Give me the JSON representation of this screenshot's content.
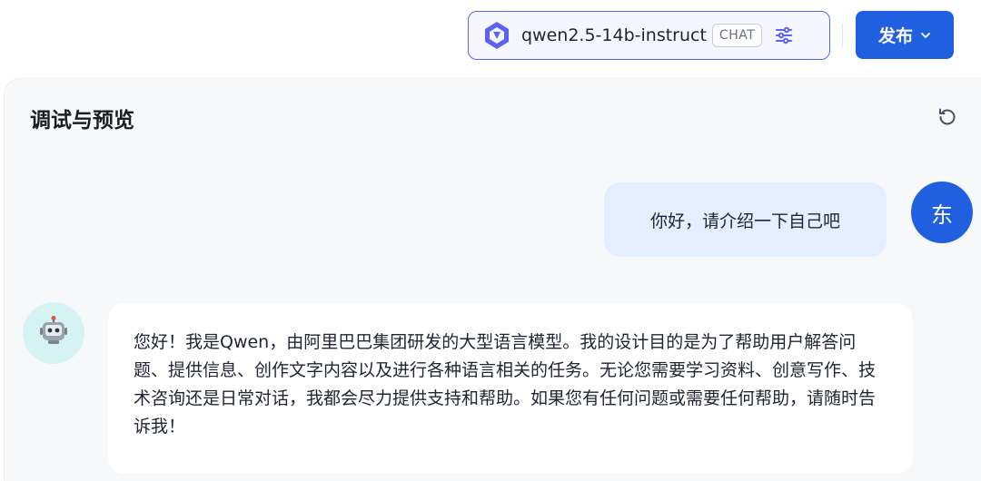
{
  "header": {
    "model_name": "qwen2.5-14b-instruct",
    "model_badge": "CHAT",
    "publish_label": "发布",
    "accent_color": "#1f5fe0",
    "selector_border_color": "#5b63f5"
  },
  "panel": {
    "title": "调试与预览"
  },
  "messages": [
    {
      "role": "user",
      "avatar_text": "东",
      "text": "你好，请介绍一下自己吧"
    },
    {
      "role": "assistant",
      "avatar_icon": "robot-icon",
      "text": "您好！我是Qwen，由阿里巴巴集团研发的大型语言模型。我的设计目的是为了帮助用户解答问题、提供信息、创作文字内容以及进行各种语言相关的任务。无论您需要学习资料、创意写作、技术咨询还是日常对话，我都会尽力提供支持和帮助。如果您有任何问题或需要任何帮助，请随时告诉我！"
    }
  ]
}
